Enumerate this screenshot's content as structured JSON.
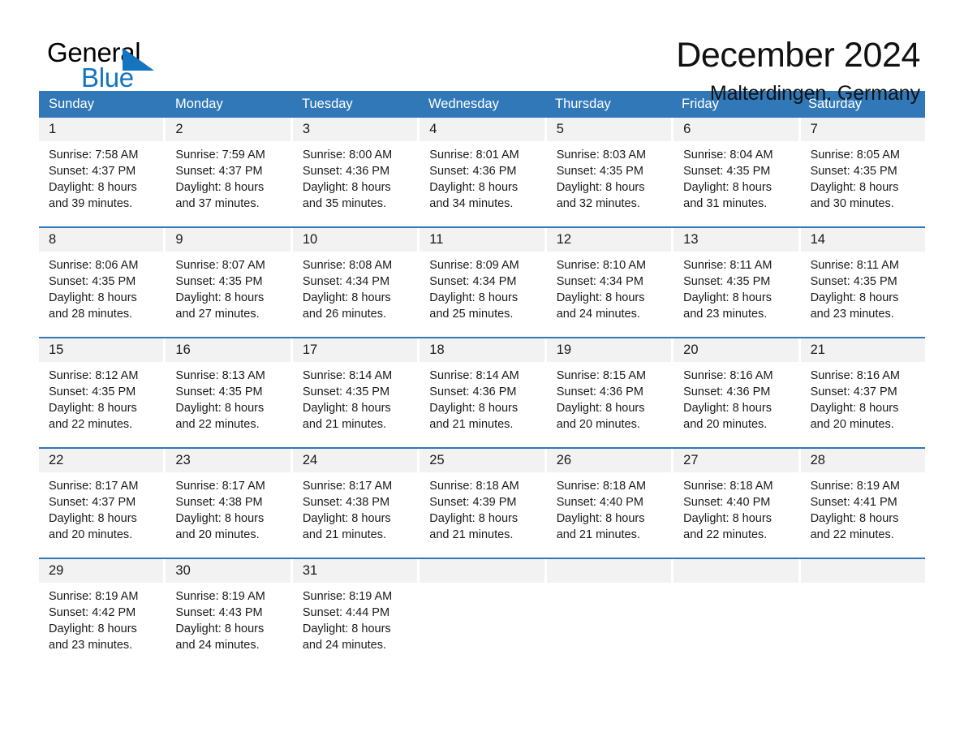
{
  "brand": {
    "name_part1": "General",
    "name_part2": "Blue",
    "accent_color": "#1574bf"
  },
  "header": {
    "title": "December 2024",
    "location": "Malterdingen, Germany"
  },
  "theme": {
    "header_blue": "#3178b8",
    "day_band_gray": "#f2f2f2"
  },
  "weekdays": [
    "Sunday",
    "Monday",
    "Tuesday",
    "Wednesday",
    "Thursday",
    "Friday",
    "Saturday"
  ],
  "weeks": [
    [
      {
        "day": "1",
        "sunrise": "Sunrise: 7:58 AM",
        "sunset": "Sunset: 4:37 PM",
        "daylight_line1": "Daylight: 8 hours",
        "daylight_line2": "and 39 minutes."
      },
      {
        "day": "2",
        "sunrise": "Sunrise: 7:59 AM",
        "sunset": "Sunset: 4:37 PM",
        "daylight_line1": "Daylight: 8 hours",
        "daylight_line2": "and 37 minutes."
      },
      {
        "day": "3",
        "sunrise": "Sunrise: 8:00 AM",
        "sunset": "Sunset: 4:36 PM",
        "daylight_line1": "Daylight: 8 hours",
        "daylight_line2": "and 35 minutes."
      },
      {
        "day": "4",
        "sunrise": "Sunrise: 8:01 AM",
        "sunset": "Sunset: 4:36 PM",
        "daylight_line1": "Daylight: 8 hours",
        "daylight_line2": "and 34 minutes."
      },
      {
        "day": "5",
        "sunrise": "Sunrise: 8:03 AM",
        "sunset": "Sunset: 4:35 PM",
        "daylight_line1": "Daylight: 8 hours",
        "daylight_line2": "and 32 minutes."
      },
      {
        "day": "6",
        "sunrise": "Sunrise: 8:04 AM",
        "sunset": "Sunset: 4:35 PM",
        "daylight_line1": "Daylight: 8 hours",
        "daylight_line2": "and 31 minutes."
      },
      {
        "day": "7",
        "sunrise": "Sunrise: 8:05 AM",
        "sunset": "Sunset: 4:35 PM",
        "daylight_line1": "Daylight: 8 hours",
        "daylight_line2": "and 30 minutes."
      }
    ],
    [
      {
        "day": "8",
        "sunrise": "Sunrise: 8:06 AM",
        "sunset": "Sunset: 4:35 PM",
        "daylight_line1": "Daylight: 8 hours",
        "daylight_line2": "and 28 minutes."
      },
      {
        "day": "9",
        "sunrise": "Sunrise: 8:07 AM",
        "sunset": "Sunset: 4:35 PM",
        "daylight_line1": "Daylight: 8 hours",
        "daylight_line2": "and 27 minutes."
      },
      {
        "day": "10",
        "sunrise": "Sunrise: 8:08 AM",
        "sunset": "Sunset: 4:34 PM",
        "daylight_line1": "Daylight: 8 hours",
        "daylight_line2": "and 26 minutes."
      },
      {
        "day": "11",
        "sunrise": "Sunrise: 8:09 AM",
        "sunset": "Sunset: 4:34 PM",
        "daylight_line1": "Daylight: 8 hours",
        "daylight_line2": "and 25 minutes."
      },
      {
        "day": "12",
        "sunrise": "Sunrise: 8:10 AM",
        "sunset": "Sunset: 4:34 PM",
        "daylight_line1": "Daylight: 8 hours",
        "daylight_line2": "and 24 minutes."
      },
      {
        "day": "13",
        "sunrise": "Sunrise: 8:11 AM",
        "sunset": "Sunset: 4:35 PM",
        "daylight_line1": "Daylight: 8 hours",
        "daylight_line2": "and 23 minutes."
      },
      {
        "day": "14",
        "sunrise": "Sunrise: 8:11 AM",
        "sunset": "Sunset: 4:35 PM",
        "daylight_line1": "Daylight: 8 hours",
        "daylight_line2": "and 23 minutes."
      }
    ],
    [
      {
        "day": "15",
        "sunrise": "Sunrise: 8:12 AM",
        "sunset": "Sunset: 4:35 PM",
        "daylight_line1": "Daylight: 8 hours",
        "daylight_line2": "and 22 minutes."
      },
      {
        "day": "16",
        "sunrise": "Sunrise: 8:13 AM",
        "sunset": "Sunset: 4:35 PM",
        "daylight_line1": "Daylight: 8 hours",
        "daylight_line2": "and 22 minutes."
      },
      {
        "day": "17",
        "sunrise": "Sunrise: 8:14 AM",
        "sunset": "Sunset: 4:35 PM",
        "daylight_line1": "Daylight: 8 hours",
        "daylight_line2": "and 21 minutes."
      },
      {
        "day": "18",
        "sunrise": "Sunrise: 8:14 AM",
        "sunset": "Sunset: 4:36 PM",
        "daylight_line1": "Daylight: 8 hours",
        "daylight_line2": "and 21 minutes."
      },
      {
        "day": "19",
        "sunrise": "Sunrise: 8:15 AM",
        "sunset": "Sunset: 4:36 PM",
        "daylight_line1": "Daylight: 8 hours",
        "daylight_line2": "and 20 minutes."
      },
      {
        "day": "20",
        "sunrise": "Sunrise: 8:16 AM",
        "sunset": "Sunset: 4:36 PM",
        "daylight_line1": "Daylight: 8 hours",
        "daylight_line2": "and 20 minutes."
      },
      {
        "day": "21",
        "sunrise": "Sunrise: 8:16 AM",
        "sunset": "Sunset: 4:37 PM",
        "daylight_line1": "Daylight: 8 hours",
        "daylight_line2": "and 20 minutes."
      }
    ],
    [
      {
        "day": "22",
        "sunrise": "Sunrise: 8:17 AM",
        "sunset": "Sunset: 4:37 PM",
        "daylight_line1": "Daylight: 8 hours",
        "daylight_line2": "and 20 minutes."
      },
      {
        "day": "23",
        "sunrise": "Sunrise: 8:17 AM",
        "sunset": "Sunset: 4:38 PM",
        "daylight_line1": "Daylight: 8 hours",
        "daylight_line2": "and 20 minutes."
      },
      {
        "day": "24",
        "sunrise": "Sunrise: 8:17 AM",
        "sunset": "Sunset: 4:38 PM",
        "daylight_line1": "Daylight: 8 hours",
        "daylight_line2": "and 21 minutes."
      },
      {
        "day": "25",
        "sunrise": "Sunrise: 8:18 AM",
        "sunset": "Sunset: 4:39 PM",
        "daylight_line1": "Daylight: 8 hours",
        "daylight_line2": "and 21 minutes."
      },
      {
        "day": "26",
        "sunrise": "Sunrise: 8:18 AM",
        "sunset": "Sunset: 4:40 PM",
        "daylight_line1": "Daylight: 8 hours",
        "daylight_line2": "and 21 minutes."
      },
      {
        "day": "27",
        "sunrise": "Sunrise: 8:18 AM",
        "sunset": "Sunset: 4:40 PM",
        "daylight_line1": "Daylight: 8 hours",
        "daylight_line2": "and 22 minutes."
      },
      {
        "day": "28",
        "sunrise": "Sunrise: 8:19 AM",
        "sunset": "Sunset: 4:41 PM",
        "daylight_line1": "Daylight: 8 hours",
        "daylight_line2": "and 22 minutes."
      }
    ],
    [
      {
        "day": "29",
        "sunrise": "Sunrise: 8:19 AM",
        "sunset": "Sunset: 4:42 PM",
        "daylight_line1": "Daylight: 8 hours",
        "daylight_line2": "and 23 minutes."
      },
      {
        "day": "30",
        "sunrise": "Sunrise: 8:19 AM",
        "sunset": "Sunset: 4:43 PM",
        "daylight_line1": "Daylight: 8 hours",
        "daylight_line2": "and 24 minutes."
      },
      {
        "day": "31",
        "sunrise": "Sunrise: 8:19 AM",
        "sunset": "Sunset: 4:44 PM",
        "daylight_line1": "Daylight: 8 hours",
        "daylight_line2": "and 24 minutes."
      },
      {
        "day": "",
        "sunrise": "",
        "sunset": "",
        "daylight_line1": "",
        "daylight_line2": ""
      },
      {
        "day": "",
        "sunrise": "",
        "sunset": "",
        "daylight_line1": "",
        "daylight_line2": ""
      },
      {
        "day": "",
        "sunrise": "",
        "sunset": "",
        "daylight_line1": "",
        "daylight_line2": ""
      },
      {
        "day": "",
        "sunrise": "",
        "sunset": "",
        "daylight_line1": "",
        "daylight_line2": ""
      }
    ]
  ]
}
